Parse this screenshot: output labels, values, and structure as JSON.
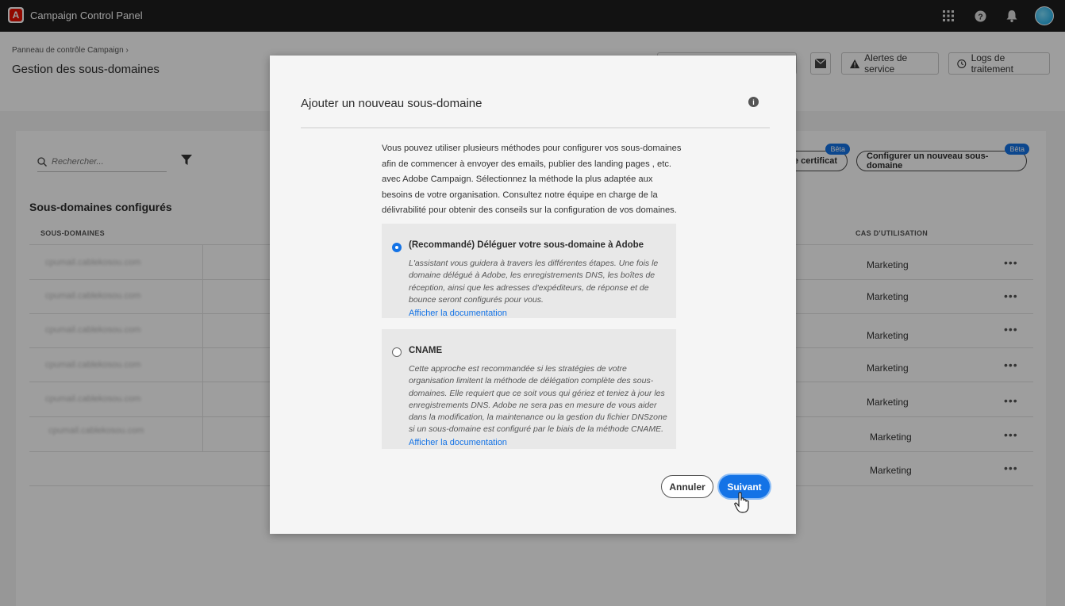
{
  "topbar": {
    "logo_letter": "A",
    "app_title": "Campaign Control Panel",
    "icons": [
      "apps-grid-icon",
      "help-icon",
      "bell-icon",
      "avatar"
    ]
  },
  "header": {
    "breadcrumb": "Panneau de contrôle Campaign",
    "breadcrumb_sep": "›",
    "title": "Gestion des sous-domaines",
    "buttons": {
      "alerts": "Alertes de service",
      "logs": "Logs de traitement"
    }
  },
  "main": {
    "search_placeholder": "Rechercher...",
    "section_title": "Sous-domaines configurés",
    "col_subdomains": "SOUS-DOMAINES",
    "col_use_cases": "CAS D'UTILISATION",
    "btn_certificate": "e certificat",
    "btn_configure": "Configurer un nouveau sous-domaine",
    "beta": "Bêta",
    "more": "•••",
    "rows": [
      {
        "name": "cpumail.cablekosou.com",
        "use": "Marketing"
      },
      {
        "name": "cpumail.cablekosou.com",
        "use": "Marketing"
      },
      {
        "name": "cpumail.cablekosou.com",
        "use": "Marketing"
      },
      {
        "name": "cpumail.cablekosou.com",
        "use": "Marketing"
      },
      {
        "name": "cpumail.cablekosou.com",
        "use": "Marketing"
      },
      {
        "name": "cpumail.cablekosou.com",
        "use": "Marketing"
      },
      {
        "name": "",
        "use": "Marketing"
      }
    ]
  },
  "modal": {
    "title": "Ajouter un nouveau sous-domaine",
    "intro": "Vous pouvez utiliser plusieurs méthodes pour configurer vos sous-domaines afin de commencer à envoyer des emails, publier des landing pages , etc. avec Adobe Campaign. Sélectionnez la méthode la plus adaptée aux besoins de votre organisation. Consultez notre équipe en charge de la délivrabilité pour obtenir des conseils sur la configuration de vos domaines.",
    "option1": {
      "title": "(Recommandé) Déléguer votre sous-domaine à Adobe",
      "desc": "L'assistant vous guidera à travers les différentes étapes. Une fois le domaine délégué à Adobe, les enregistrements DNS, les boîtes de réception, ainsi que les adresses d'expéditeurs, de réponse et de bounce seront configurés pour vous.",
      "link": "Afficher la documentation",
      "selected": true
    },
    "option2": {
      "title": "CNAME",
      "desc": "Cette approche est recommandée si les stratégies de votre organisation limitent la méthode de délégation complète des sous-domaines. Elle requiert que ce soit vous qui gériez et teniez à jour les enregistrements DNS. Adobe ne sera pas en mesure de vous aider dans la modification, la maintenance ou la gestion du fichier DNSzone si un sous-domaine est configuré par le biais de la méthode CNAME.",
      "link": "Afficher la documentation",
      "selected": false
    },
    "cancel": "Annuler",
    "next": "Suivant"
  }
}
